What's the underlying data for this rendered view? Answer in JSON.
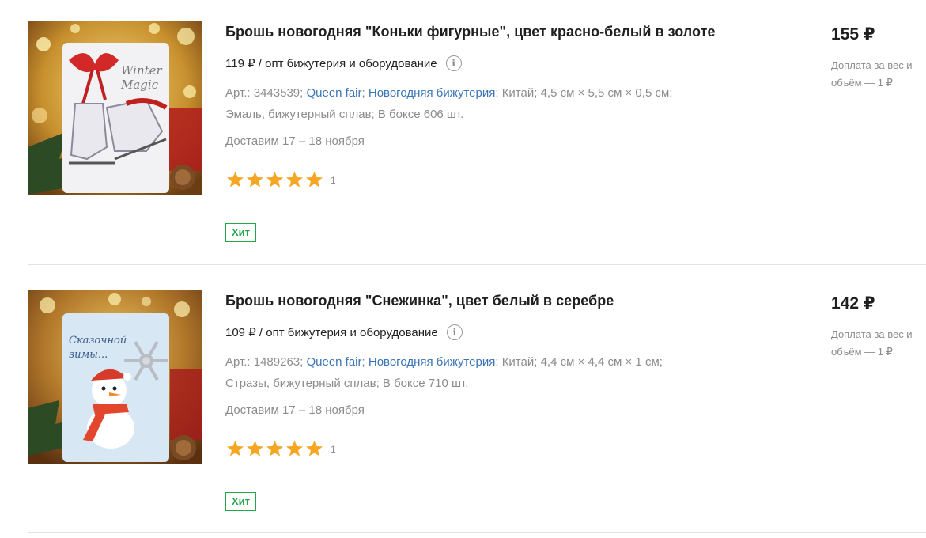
{
  "products": [
    {
      "title": "Брошь новогодняя \"Коньки фигурные\", цвет красно-белый в золоте",
      "wholesale": "119 ₽ / опт бижутерия и оборудование",
      "art_label": "Арт.: 3443539;",
      "brand": "Queen fair",
      "category": "Новогодняя бижутерия",
      "country": "Китай;",
      "size": "4,5 см × 5,5 см × 0,5 см;",
      "material": "Эмаль, бижутерный сплав;",
      "box": "В боксе 606 шт.",
      "delivery": "Доставим 17 – 18 ноября",
      "rating_stars": 5,
      "reviews": "1",
      "badge": "Хит",
      "price": "155 ₽",
      "surcharge": "Доплата за вес и объём — 1 ₽",
      "image_text": [
        "Winter",
        "Magic"
      ]
    },
    {
      "title": "Брошь новогодняя \"Снежинка\", цвет белый в серебре",
      "wholesale": "109 ₽ / опт бижутерия и оборудование",
      "art_label": "Арт.: 1489263;",
      "brand": "Queen fair",
      "category": "Новогодняя бижутерия",
      "country": "Китай;",
      "size": "4,4 см × 4,4 см × 1 см;",
      "material": "Стразы, бижутерный сплав;",
      "box": "В боксе 710 шт.",
      "delivery": "Доставим 17 – 18 ноября",
      "rating_stars": 5,
      "reviews": "1",
      "badge": "Хит",
      "price": "142 ₽",
      "surcharge": "Доплата за вес и объём — 1 ₽",
      "image_text": [
        "Сказочной",
        "зимы..."
      ]
    }
  ],
  "colors": {
    "link": "#3b75b6",
    "badge": "#22a84b",
    "star": "#f5a623",
    "muted": "#8c8c8c"
  },
  "icons": {
    "info": "info-circle-icon",
    "star": "star-icon"
  }
}
